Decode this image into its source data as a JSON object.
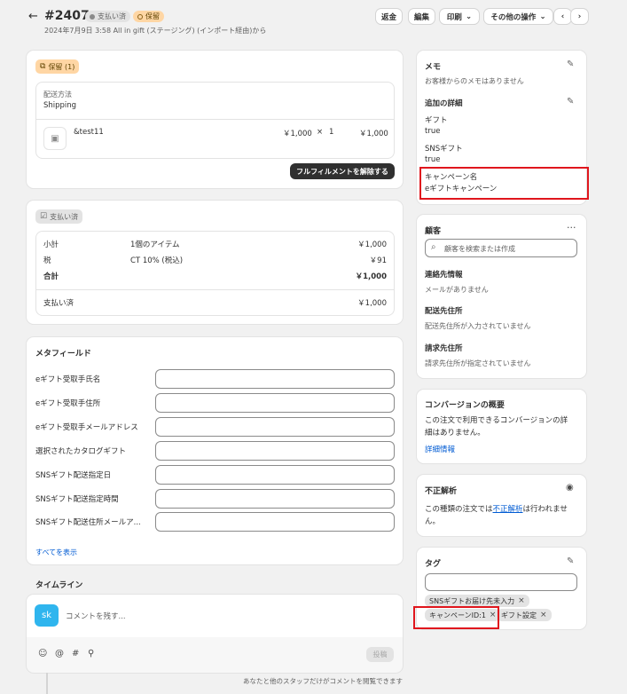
{
  "header": {
    "order_number": "#2407",
    "badge_payment": "支払い済",
    "badge_status": "保留",
    "subtitle": "2024年7月9日 3:58 All in gift (ステージング) (インポート経由)から",
    "refund": "返金",
    "edit": "編集",
    "print": "印刷",
    "more_actions": "その他の操作"
  },
  "fulfillment": {
    "badge": "保留 (1)",
    "shipping_method_label": "配送方法",
    "shipping_method_value": "Shipping",
    "item_name": "&test11",
    "item_price": "￥1,000",
    "item_times": "×",
    "item_qty": "1",
    "item_total": "￥1,000",
    "release_button": "フルフィルメントを解除する"
  },
  "payment": {
    "badge": "支払い済",
    "subtotal_label": "小計",
    "subtotal_desc": "1個のアイテム",
    "subtotal_value": "￥1,000",
    "tax_label": "税",
    "tax_desc": "CT 10% (税込)",
    "tax_value": "￥91",
    "total_label": "合計",
    "total_value": "￥1,000",
    "paid_label": "支払い済",
    "paid_value": "￥1,000"
  },
  "metafields": {
    "title": "メタフィールド",
    "fields": [
      "eギフト受取手氏名",
      "eギフト受取手住所",
      "eギフト受取手メールアドレス",
      "選択されたカタログギフト",
      "SNSギフト配送指定日",
      "SNSギフト配送指定時間",
      "SNSギフト配送住所メールア..."
    ],
    "show_all": "すべてを表示"
  },
  "timeline": {
    "title": "タイムライン",
    "avatar": "sk",
    "comment_placeholder": "コメントを残す...",
    "post": "投稿",
    "footer_note": "あなたと他のスタッフだけがコメントを閲覧できます"
  },
  "notes": {
    "title": "メモ",
    "empty": "お客様からのメモはありません",
    "additional_title": "追加の詳細",
    "gift_label": "ギフト",
    "gift_value": "true",
    "sns_label": "SNSギフト",
    "sns_value": "true",
    "campaign_label": "キャンペーン名",
    "campaign_value": "eギフトキャンペーン"
  },
  "customer": {
    "title": "顧客",
    "search_placeholder": "顧客を検索または作成",
    "contact_title": "連絡先情報",
    "contact_value": "メールがありません",
    "shipping_title": "配送先住所",
    "shipping_value": "配送先住所が入力されていません",
    "billing_title": "請求先住所",
    "billing_value": "請求先住所が指定されていません"
  },
  "conversion": {
    "title": "コンバージョンの概要",
    "text_line1": "この注文で利用できるコンバージョンの詳",
    "text_line2": "細はありません。",
    "link": "詳細情報"
  },
  "fraud": {
    "title": "不正解析",
    "text_before": "この種類の注文では",
    "text_link": "不正解析",
    "text_after": "は行われませ",
    "text_line2": "ん。"
  },
  "tags": {
    "title": "タグ",
    "items": [
      "SNSギフトお届け先未入力",
      "キャンペーンID:1",
      "ギフト設定"
    ]
  },
  "icons": {
    "back": "arrow-left-icon",
    "pencil": "pencil-icon",
    "more": "ellipsis-icon",
    "search": "search-icon",
    "eye": "eye-icon"
  },
  "colors": {
    "highlight": "#e0161d",
    "primary_button": "#303030",
    "link": "#005bd3",
    "avatar": "#2fb5ee",
    "hold_badge": "#ffd6a4"
  }
}
